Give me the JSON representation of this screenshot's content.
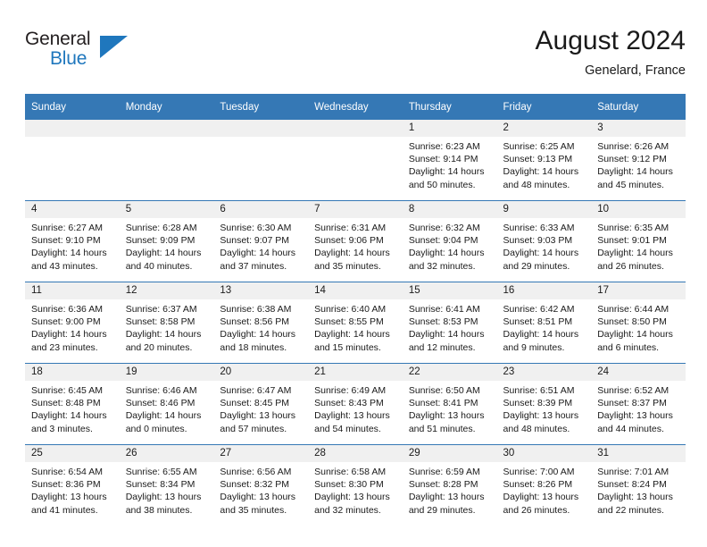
{
  "logo": {
    "word_top": "General",
    "word_bottom": "Blue",
    "triangle_color": "#1f77bd"
  },
  "header": {
    "title": "August 2024",
    "subtitle": "Genelard, France"
  },
  "theme": {
    "header_blue": "#3578b5",
    "band_gray": "#f0f0f0",
    "text": "#1a1a1a"
  },
  "calendar": {
    "weekday_headers": [
      "Sunday",
      "Monday",
      "Tuesday",
      "Wednesday",
      "Thursday",
      "Friday",
      "Saturday"
    ],
    "labels": {
      "sunrise": "Sunrise:",
      "sunset": "Sunset:",
      "daylight": "Daylight:"
    },
    "weeks": [
      [
        {
          "day": "",
          "empty": true
        },
        {
          "day": "",
          "empty": true
        },
        {
          "day": "",
          "empty": true
        },
        {
          "day": "",
          "empty": true
        },
        {
          "day": "1",
          "sunrise": "Sunrise: 6:23 AM",
          "sunset": "Sunset: 9:14 PM",
          "daylight_line1": "Daylight: 14 hours",
          "daylight_line2": "and 50 minutes."
        },
        {
          "day": "2",
          "sunrise": "Sunrise: 6:25 AM",
          "sunset": "Sunset: 9:13 PM",
          "daylight_line1": "Daylight: 14 hours",
          "daylight_line2": "and 48 minutes."
        },
        {
          "day": "3",
          "sunrise": "Sunrise: 6:26 AM",
          "sunset": "Sunset: 9:12 PM",
          "daylight_line1": "Daylight: 14 hours",
          "daylight_line2": "and 45 minutes."
        }
      ],
      [
        {
          "day": "4",
          "sunrise": "Sunrise: 6:27 AM",
          "sunset": "Sunset: 9:10 PM",
          "daylight_line1": "Daylight: 14 hours",
          "daylight_line2": "and 43 minutes."
        },
        {
          "day": "5",
          "sunrise": "Sunrise: 6:28 AM",
          "sunset": "Sunset: 9:09 PM",
          "daylight_line1": "Daylight: 14 hours",
          "daylight_line2": "and 40 minutes."
        },
        {
          "day": "6",
          "sunrise": "Sunrise: 6:30 AM",
          "sunset": "Sunset: 9:07 PM",
          "daylight_line1": "Daylight: 14 hours",
          "daylight_line2": "and 37 minutes."
        },
        {
          "day": "7",
          "sunrise": "Sunrise: 6:31 AM",
          "sunset": "Sunset: 9:06 PM",
          "daylight_line1": "Daylight: 14 hours",
          "daylight_line2": "and 35 minutes."
        },
        {
          "day": "8",
          "sunrise": "Sunrise: 6:32 AM",
          "sunset": "Sunset: 9:04 PM",
          "daylight_line1": "Daylight: 14 hours",
          "daylight_line2": "and 32 minutes."
        },
        {
          "day": "9",
          "sunrise": "Sunrise: 6:33 AM",
          "sunset": "Sunset: 9:03 PM",
          "daylight_line1": "Daylight: 14 hours",
          "daylight_line2": "and 29 minutes."
        },
        {
          "day": "10",
          "sunrise": "Sunrise: 6:35 AM",
          "sunset": "Sunset: 9:01 PM",
          "daylight_line1": "Daylight: 14 hours",
          "daylight_line2": "and 26 minutes."
        }
      ],
      [
        {
          "day": "11",
          "sunrise": "Sunrise: 6:36 AM",
          "sunset": "Sunset: 9:00 PM",
          "daylight_line1": "Daylight: 14 hours",
          "daylight_line2": "and 23 minutes."
        },
        {
          "day": "12",
          "sunrise": "Sunrise: 6:37 AM",
          "sunset": "Sunset: 8:58 PM",
          "daylight_line1": "Daylight: 14 hours",
          "daylight_line2": "and 20 minutes."
        },
        {
          "day": "13",
          "sunrise": "Sunrise: 6:38 AM",
          "sunset": "Sunset: 8:56 PM",
          "daylight_line1": "Daylight: 14 hours",
          "daylight_line2": "and 18 minutes."
        },
        {
          "day": "14",
          "sunrise": "Sunrise: 6:40 AM",
          "sunset": "Sunset: 8:55 PM",
          "daylight_line1": "Daylight: 14 hours",
          "daylight_line2": "and 15 minutes."
        },
        {
          "day": "15",
          "sunrise": "Sunrise: 6:41 AM",
          "sunset": "Sunset: 8:53 PM",
          "daylight_line1": "Daylight: 14 hours",
          "daylight_line2": "and 12 minutes."
        },
        {
          "day": "16",
          "sunrise": "Sunrise: 6:42 AM",
          "sunset": "Sunset: 8:51 PM",
          "daylight_line1": "Daylight: 14 hours",
          "daylight_line2": "and 9 minutes."
        },
        {
          "day": "17",
          "sunrise": "Sunrise: 6:44 AM",
          "sunset": "Sunset: 8:50 PM",
          "daylight_line1": "Daylight: 14 hours",
          "daylight_line2": "and 6 minutes."
        }
      ],
      [
        {
          "day": "18",
          "sunrise": "Sunrise: 6:45 AM",
          "sunset": "Sunset: 8:48 PM",
          "daylight_line1": "Daylight: 14 hours",
          "daylight_line2": "and 3 minutes."
        },
        {
          "day": "19",
          "sunrise": "Sunrise: 6:46 AM",
          "sunset": "Sunset: 8:46 PM",
          "daylight_line1": "Daylight: 14 hours",
          "daylight_line2": "and 0 minutes."
        },
        {
          "day": "20",
          "sunrise": "Sunrise: 6:47 AM",
          "sunset": "Sunset: 8:45 PM",
          "daylight_line1": "Daylight: 13 hours",
          "daylight_line2": "and 57 minutes."
        },
        {
          "day": "21",
          "sunrise": "Sunrise: 6:49 AM",
          "sunset": "Sunset: 8:43 PM",
          "daylight_line1": "Daylight: 13 hours",
          "daylight_line2": "and 54 minutes."
        },
        {
          "day": "22",
          "sunrise": "Sunrise: 6:50 AM",
          "sunset": "Sunset: 8:41 PM",
          "daylight_line1": "Daylight: 13 hours",
          "daylight_line2": "and 51 minutes."
        },
        {
          "day": "23",
          "sunrise": "Sunrise: 6:51 AM",
          "sunset": "Sunset: 8:39 PM",
          "daylight_line1": "Daylight: 13 hours",
          "daylight_line2": "and 48 minutes."
        },
        {
          "day": "24",
          "sunrise": "Sunrise: 6:52 AM",
          "sunset": "Sunset: 8:37 PM",
          "daylight_line1": "Daylight: 13 hours",
          "daylight_line2": "and 44 minutes."
        }
      ],
      [
        {
          "day": "25",
          "sunrise": "Sunrise: 6:54 AM",
          "sunset": "Sunset: 8:36 PM",
          "daylight_line1": "Daylight: 13 hours",
          "daylight_line2": "and 41 minutes."
        },
        {
          "day": "26",
          "sunrise": "Sunrise: 6:55 AM",
          "sunset": "Sunset: 8:34 PM",
          "daylight_line1": "Daylight: 13 hours",
          "daylight_line2": "and 38 minutes."
        },
        {
          "day": "27",
          "sunrise": "Sunrise: 6:56 AM",
          "sunset": "Sunset: 8:32 PM",
          "daylight_line1": "Daylight: 13 hours",
          "daylight_line2": "and 35 minutes."
        },
        {
          "day": "28",
          "sunrise": "Sunrise: 6:58 AM",
          "sunset": "Sunset: 8:30 PM",
          "daylight_line1": "Daylight: 13 hours",
          "daylight_line2": "and 32 minutes."
        },
        {
          "day": "29",
          "sunrise": "Sunrise: 6:59 AM",
          "sunset": "Sunset: 8:28 PM",
          "daylight_line1": "Daylight: 13 hours",
          "daylight_line2": "and 29 minutes."
        },
        {
          "day": "30",
          "sunrise": "Sunrise: 7:00 AM",
          "sunset": "Sunset: 8:26 PM",
          "daylight_line1": "Daylight: 13 hours",
          "daylight_line2": "and 26 minutes."
        },
        {
          "day": "31",
          "sunrise": "Sunrise: 7:01 AM",
          "sunset": "Sunset: 8:24 PM",
          "daylight_line1": "Daylight: 13 hours",
          "daylight_line2": "and 22 minutes."
        }
      ]
    ]
  }
}
